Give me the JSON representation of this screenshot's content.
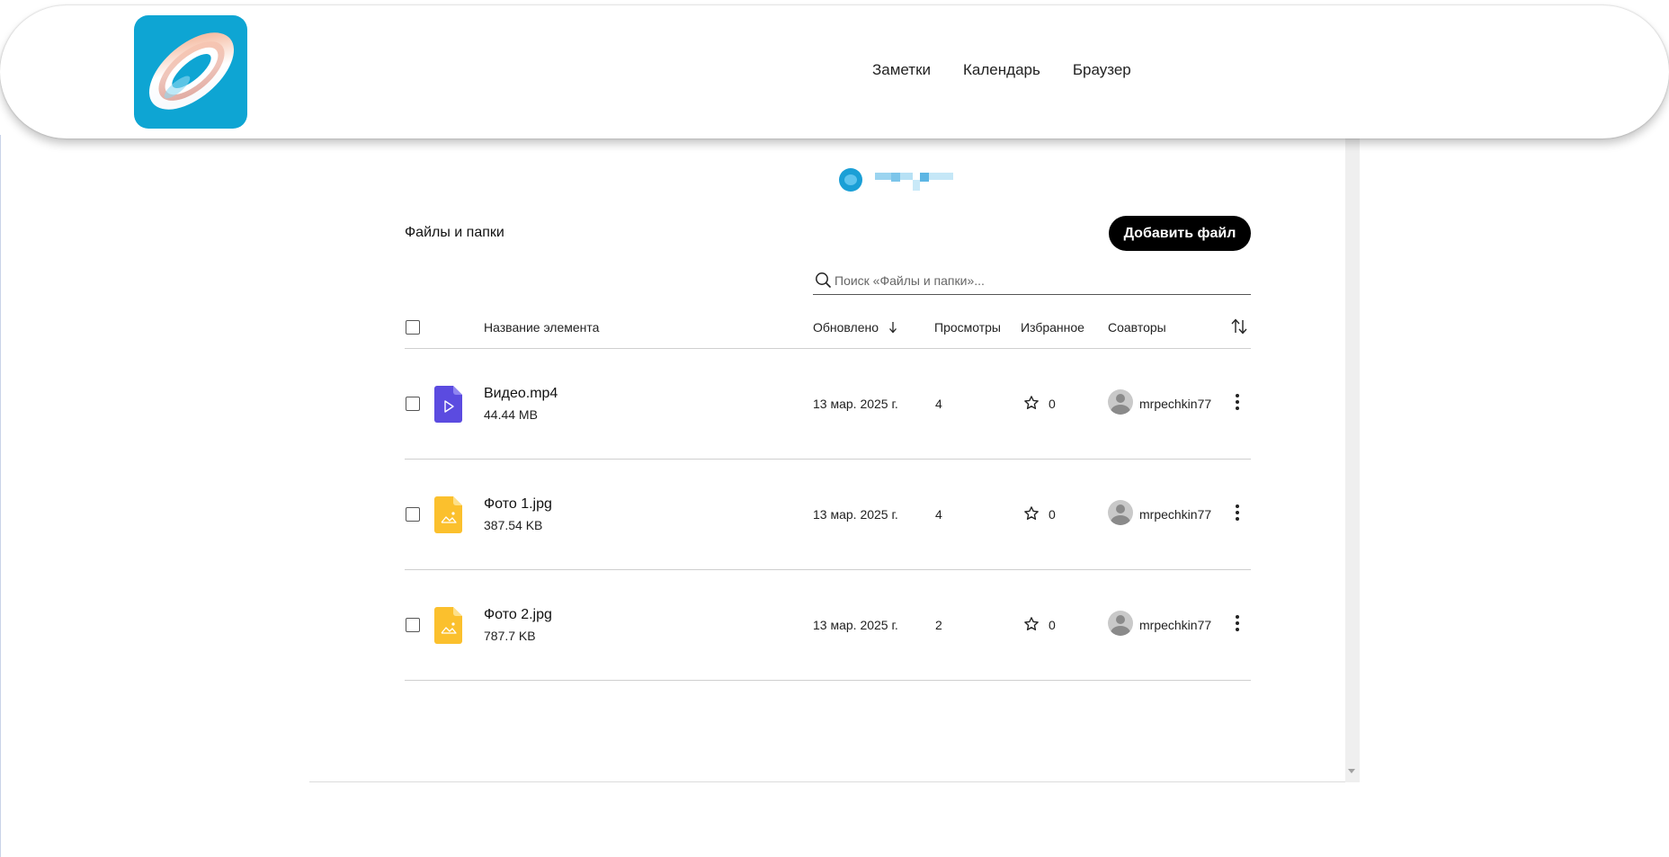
{
  "header": {
    "nav": [
      "Заметки",
      "Календарь",
      "Браузер"
    ]
  },
  "files": {
    "title": "Файлы и папки",
    "add_button": "Добавить файл",
    "search_placeholder": "Поиск «Файлы и папки»...",
    "columns": {
      "name": "Название элемента",
      "updated": "Обновлено",
      "views": "Просмотры",
      "favorites": "Избранное",
      "coauthors": "Соавторы"
    },
    "rows": [
      {
        "name": "Видео.mp4",
        "size": "44.44 MB",
        "updated": "13 мар. 2025 г.",
        "views": "4",
        "favorites": "0",
        "author": "mrpechkin77",
        "type": "video",
        "icon_color": "#5b4be0"
      },
      {
        "name": "Фото 1.jpg",
        "size": "387.54 KB",
        "updated": "13 мар. 2025 г.",
        "views": "4",
        "favorites": "0",
        "author": "mrpechkin77",
        "type": "image",
        "icon_color": "#fbc02d"
      },
      {
        "name": "Фото 2.jpg",
        "size": "787.7 KB",
        "updated": "13 мар. 2025 г.",
        "views": "2",
        "favorites": "0",
        "author": "mrpechkin77",
        "type": "image",
        "icon_color": "#fbc02d"
      }
    ]
  },
  "icons": {
    "search": "search-icon",
    "sort_down": "arrow-down-icon",
    "sort_toggle": "sort-icon",
    "star": "star-icon",
    "more": "more-vertical-icon"
  },
  "colors": {
    "accent": "#0ea5d3",
    "button_bg": "#000000"
  }
}
